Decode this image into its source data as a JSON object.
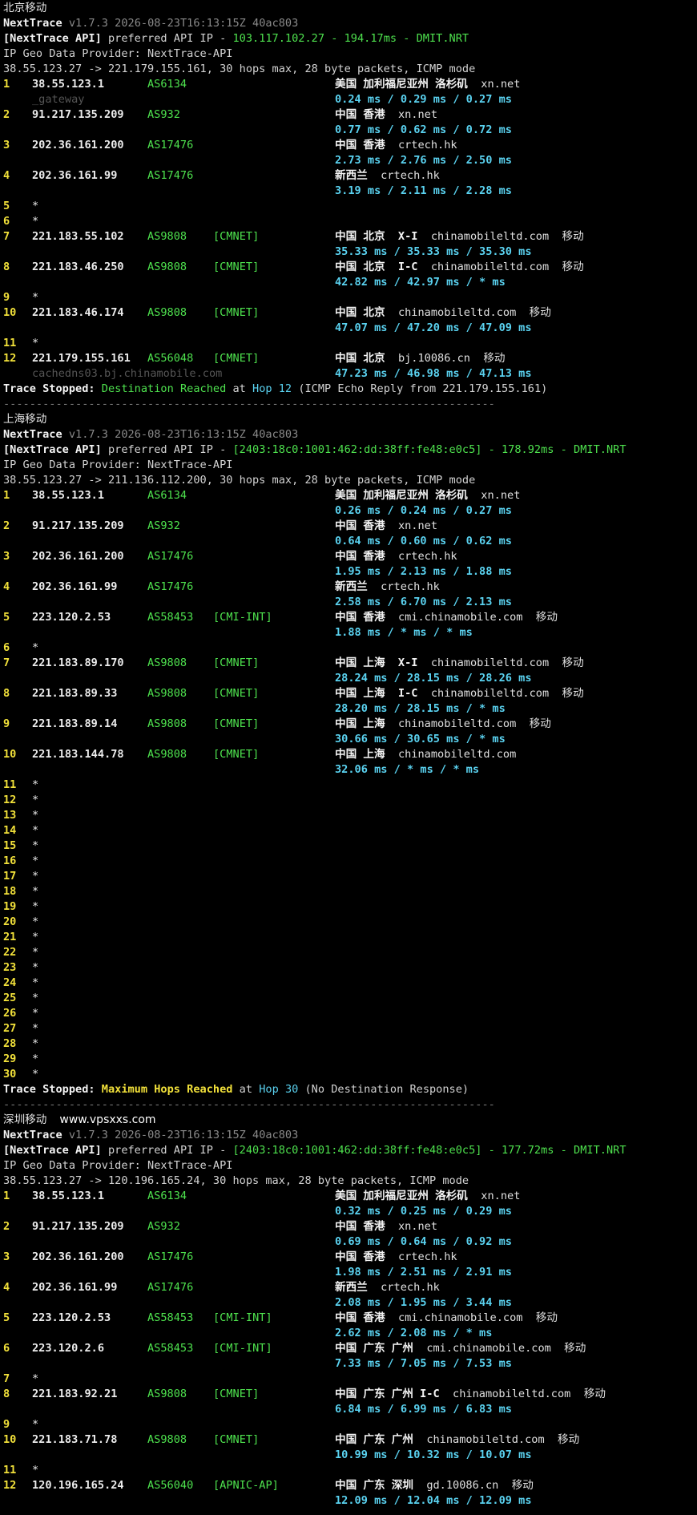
{
  "sections": [
    {
      "title": "北京移动",
      "version": "v1.7.3 2026-08-23T16:13:15Z 40ac803",
      "api_ip": "103.117.102.27 - 194.17ms - DMIT.NRT",
      "provider": "IP Geo Data Provider: NextTrace-API",
      "route": "38.55.123.27 -> 221.179.155.161, 30 hops max, 28 byte packets, ICMP mode",
      "hops": [
        {
          "n": "1",
          "ip": "38.55.123.1",
          "asn": "AS6134",
          "tag": "",
          "geo": "美国 加利福尼亚州 洛杉矶",
          "host": "xn.net",
          "rtt": "0.24 ms / 0.29 ms / 0.27 ms",
          "rdns": "_gateway"
        },
        {
          "n": "2",
          "ip": "91.217.135.209",
          "asn": "AS932",
          "tag": "",
          "geo": "中国 香港",
          "host": "xn.net",
          "rtt": "0.77 ms / 0.62 ms / 0.72 ms"
        },
        {
          "n": "3",
          "ip": "202.36.161.200",
          "asn": "AS17476",
          "tag": "",
          "geo": "中国 香港",
          "host": "crtech.hk",
          "rtt": "2.73 ms / 2.76 ms / 2.50 ms"
        },
        {
          "n": "4",
          "ip": "202.36.161.99",
          "asn": "AS17476",
          "tag": "",
          "geo": "新西兰",
          "host": "crtech.hk",
          "rtt": "3.19 ms / 2.11 ms / 2.28 ms"
        },
        {
          "n": "5",
          "star": true
        },
        {
          "n": "6",
          "star": true
        },
        {
          "n": "7",
          "ip": "221.183.55.102",
          "asn": "AS9808",
          "tag": "[CMNET]",
          "geo": "中国 北京  X-I",
          "host": "chinamobileltd.com  移动",
          "rtt": "35.33 ms / 35.33 ms / 35.30 ms"
        },
        {
          "n": "8",
          "ip": "221.183.46.250",
          "asn": "AS9808",
          "tag": "[CMNET]",
          "geo": "中国 北京  I-C",
          "host": "chinamobileltd.com  移动",
          "rtt": "42.82 ms / 42.97 ms / * ms"
        },
        {
          "n": "9",
          "star": true
        },
        {
          "n": "10",
          "ip": "221.183.46.174",
          "asn": "AS9808",
          "tag": "[CMNET]",
          "geo": "中国 北京",
          "host": "chinamobileltd.com  移动",
          "rtt": "47.07 ms / 47.20 ms / 47.09 ms"
        },
        {
          "n": "11",
          "star": true
        },
        {
          "n": "12",
          "ip": "221.179.155.161",
          "asn": "AS56048",
          "tag": "[CMNET]",
          "geo": "中国 北京",
          "host": "bj.10086.cn  移动",
          "rtt": "47.23 ms / 46.98 ms / 47.13 ms",
          "rdns": "cachedns03.bj.chinamobile.com"
        }
      ],
      "stop_status": "Destination Reached",
      "stop_hop": "Hop 12",
      "stop_note": "(ICMP Echo Reply from 221.179.155.161)"
    },
    {
      "title": "上海移动",
      "version": "v1.7.3 2026-08-23T16:13:15Z 40ac803",
      "api_ip": "[2403:18c0:1001:462:dd:38ff:fe48:e0c5] - 178.92ms - DMIT.NRT",
      "provider": "IP Geo Data Provider: NextTrace-API",
      "route": "38.55.123.27 -> 211.136.112.200, 30 hops max, 28 byte packets, ICMP mode",
      "hops": [
        {
          "n": "1",
          "ip": "38.55.123.1",
          "asn": "AS6134",
          "tag": "",
          "geo": "美国 加利福尼亚州 洛杉矶",
          "host": "xn.net",
          "rtt": "0.26 ms / 0.24 ms / 0.27 ms"
        },
        {
          "n": "2",
          "ip": "91.217.135.209",
          "asn": "AS932",
          "tag": "",
          "geo": "中国 香港",
          "host": "xn.net",
          "rtt": "0.64 ms / 0.60 ms / 0.62 ms"
        },
        {
          "n": "3",
          "ip": "202.36.161.200",
          "asn": "AS17476",
          "tag": "",
          "geo": "中国 香港",
          "host": "crtech.hk",
          "rtt": "1.95 ms / 2.13 ms / 1.88 ms"
        },
        {
          "n": "4",
          "ip": "202.36.161.99",
          "asn": "AS17476",
          "tag": "",
          "geo": "新西兰",
          "host": "crtech.hk",
          "rtt": "2.58 ms / 6.70 ms / 2.13 ms"
        },
        {
          "n": "5",
          "ip": "223.120.2.53",
          "asn": "AS58453",
          "tag": "[CMI-INT]",
          "geo": "中国 香港",
          "host": "cmi.chinamobile.com  移动",
          "rtt": "1.88 ms / * ms / * ms"
        },
        {
          "n": "6",
          "star": true
        },
        {
          "n": "7",
          "ip": "221.183.89.170",
          "asn": "AS9808",
          "tag": "[CMNET]",
          "geo": "中国 上海  X-I",
          "host": "chinamobileltd.com  移动",
          "rtt": "28.24 ms / 28.15 ms / 28.26 ms"
        },
        {
          "n": "8",
          "ip": "221.183.89.33",
          "asn": "AS9808",
          "tag": "[CMNET]",
          "geo": "中国 上海  I-C",
          "host": "chinamobileltd.com  移动",
          "rtt": "28.20 ms / 28.15 ms / * ms"
        },
        {
          "n": "9",
          "ip": "221.183.89.14",
          "asn": "AS9808",
          "tag": "[CMNET]",
          "geo": "中国 上海",
          "host": "chinamobileltd.com  移动",
          "rtt": "30.66 ms / 30.65 ms / * ms"
        },
        {
          "n": "10",
          "ip": "221.183.144.78",
          "asn": "AS9808",
          "tag": "[CMNET]",
          "geo": "中国 上海",
          "host": "chinamobileltd.com",
          "rtt": "32.06 ms / * ms / * ms"
        },
        {
          "n": "11",
          "star": true
        },
        {
          "n": "12",
          "star": true
        },
        {
          "n": "13",
          "star": true
        },
        {
          "n": "14",
          "star": true
        },
        {
          "n": "15",
          "star": true
        },
        {
          "n": "16",
          "star": true
        },
        {
          "n": "17",
          "star": true
        },
        {
          "n": "18",
          "star": true
        },
        {
          "n": "19",
          "star": true
        },
        {
          "n": "20",
          "star": true
        },
        {
          "n": "21",
          "star": true
        },
        {
          "n": "22",
          "star": true
        },
        {
          "n": "23",
          "star": true
        },
        {
          "n": "24",
          "star": true
        },
        {
          "n": "25",
          "star": true
        },
        {
          "n": "26",
          "star": true
        },
        {
          "n": "27",
          "star": true
        },
        {
          "n": "28",
          "star": true
        },
        {
          "n": "29",
          "star": true
        },
        {
          "n": "30",
          "star": true
        }
      ],
      "stop_status": "Maximum Hops Reached",
      "stop_hop": "Hop 30",
      "stop_note": "(No Destination Response)"
    },
    {
      "title": "深圳移动",
      "watermark": "www.vpsxxs.com",
      "version": "v1.7.3 2026-08-23T16:13:15Z 40ac803",
      "api_ip": "[2403:18c0:1001:462:dd:38ff:fe48:e0c5] - 177.72ms - DMIT.NRT",
      "provider": "IP Geo Data Provider: NextTrace-API",
      "route": "38.55.123.27 -> 120.196.165.24, 30 hops max, 28 byte packets, ICMP mode",
      "hops": [
        {
          "n": "1",
          "ip": "38.55.123.1",
          "asn": "AS6134",
          "tag": "",
          "geo": "美国 加利福尼亚州 洛杉矶",
          "host": "xn.net",
          "rtt": "0.32 ms / 0.25 ms / 0.29 ms"
        },
        {
          "n": "2",
          "ip": "91.217.135.209",
          "asn": "AS932",
          "tag": "",
          "geo": "中国 香港",
          "host": "xn.net",
          "rtt": "0.69 ms / 0.64 ms / 0.92 ms"
        },
        {
          "n": "3",
          "ip": "202.36.161.200",
          "asn": "AS17476",
          "tag": "",
          "geo": "中国 香港",
          "host": "crtech.hk",
          "rtt": "1.98 ms / 2.51 ms / 2.91 ms"
        },
        {
          "n": "4",
          "ip": "202.36.161.99",
          "asn": "AS17476",
          "tag": "",
          "geo": "新西兰",
          "host": "crtech.hk",
          "rtt": "2.08 ms / 1.95 ms / 3.44 ms"
        },
        {
          "n": "5",
          "ip": "223.120.2.53",
          "asn": "AS58453",
          "tag": "[CMI-INT]",
          "geo": "中国 香港",
          "host": "cmi.chinamobile.com  移动",
          "rtt": "2.62 ms / 2.08 ms / * ms"
        },
        {
          "n": "6",
          "ip": "223.120.2.6",
          "asn": "AS58453",
          "tag": "[CMI-INT]",
          "geo": "中国 广东 广州",
          "host": "cmi.chinamobile.com  移动",
          "rtt": "7.33 ms / 7.05 ms / 7.53 ms"
        },
        {
          "n": "7",
          "star": true
        },
        {
          "n": "8",
          "ip": "221.183.92.21",
          "asn": "AS9808",
          "tag": "[CMNET]",
          "geo": "中国 广东 广州 I-C",
          "host": "chinamobileltd.com  移动",
          "rtt": "6.84 ms / 6.99 ms / 6.83 ms"
        },
        {
          "n": "9",
          "star": true
        },
        {
          "n": "10",
          "ip": "221.183.71.78",
          "asn": "AS9808",
          "tag": "[CMNET]",
          "geo": "中国 广东 广州",
          "host": "chinamobileltd.com  移动",
          "rtt": "10.99 ms / 10.32 ms / 10.07 ms"
        },
        {
          "n": "11",
          "star": true
        },
        {
          "n": "12",
          "ip": "120.196.165.24",
          "asn": "AS56040",
          "tag": "[APNIC-AP]",
          "geo": "中国 广东 深圳",
          "host": "gd.10086.cn  移动",
          "rtt": "12.09 ms / 12.04 ms / 12.09 ms"
        }
      ]
    }
  ],
  "labels": {
    "app": "NextTrace",
    "api_prefix": "[NextTrace API]",
    "api_mid": " preferred API IP - ",
    "stop_prefix": "Trace Stopped:",
    "at": " at ",
    "star": "*",
    "separator": "---------------------------------------------------------------------------"
  }
}
